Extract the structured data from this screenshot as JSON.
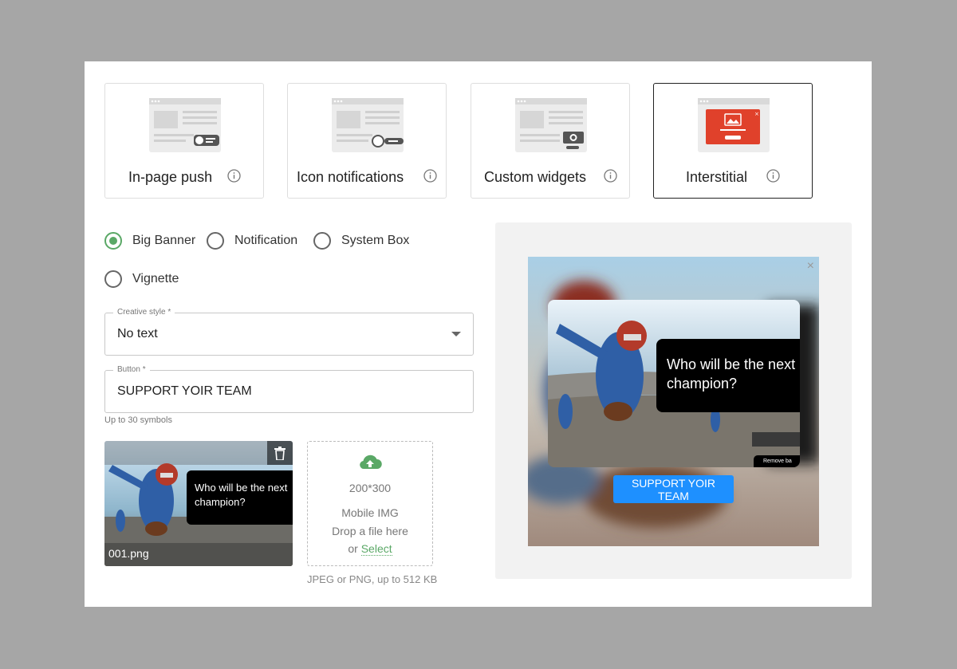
{
  "formats": [
    {
      "label": "In-page push",
      "info_icon": "info-icon"
    },
    {
      "label": "Icon notifications",
      "info_icon": "info-icon"
    },
    {
      "label": "Custom widgets",
      "info_icon": "info-icon"
    },
    {
      "label": "Interstitial",
      "info_icon": "info-icon",
      "selected": true
    }
  ],
  "variants": [
    {
      "label": "Big Banner",
      "checked": true
    },
    {
      "label": "Notification",
      "checked": false
    },
    {
      "label": "System Box",
      "checked": false
    },
    {
      "label": "Vignette",
      "checked": false
    }
  ],
  "creative_style": {
    "label": "Creative style *",
    "value": "No text"
  },
  "button_field": {
    "label": "Button *",
    "value": "SUPPORT YOIR TEAM",
    "hint": "Up to 30 symbols"
  },
  "uploaded_image": {
    "filename": "001.png",
    "card_text": "Who will be the next champion?"
  },
  "dropzone": {
    "size": "200*300",
    "type": "Mobile IMG",
    "drop_text": "Drop a file here",
    "or_text": "or",
    "select_label": "Select",
    "note": "JPEG or PNG, up to 512 KB"
  },
  "preview": {
    "close": "×",
    "card_text": "Who will be the next champion?",
    "badge_text": "Remove ba",
    "button_label": "SUPPORT YOIR TEAM"
  },
  "colors": {
    "accent_green": "#5aa866",
    "button_blue": "#1e90ff",
    "interstitial_red": "#e0412b"
  }
}
